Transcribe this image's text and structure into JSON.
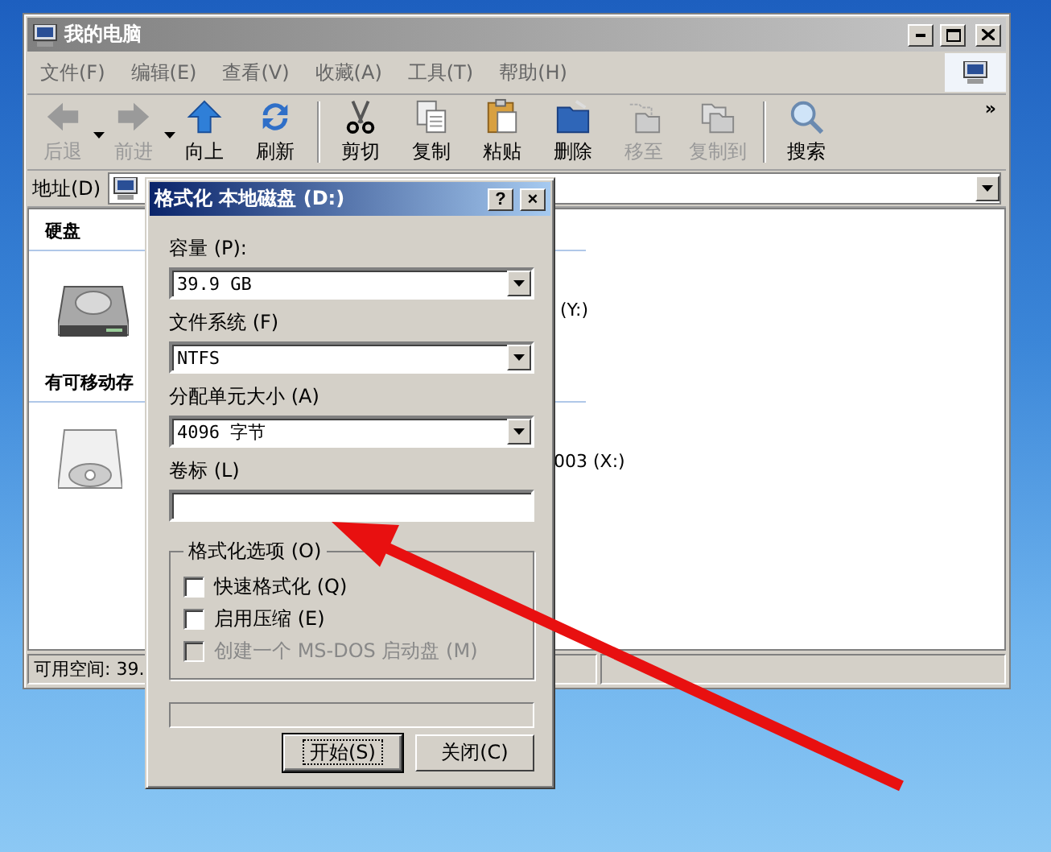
{
  "explorer": {
    "title": "我的电脑",
    "menu": [
      "文件(F)",
      "编辑(E)",
      "查看(V)",
      "收藏(A)",
      "工具(T)",
      "帮助(H)"
    ],
    "toolbar": [
      {
        "kind": "back",
        "label": "后退",
        "disabled": true,
        "dropdown": true
      },
      {
        "kind": "forward",
        "label": "前进",
        "disabled": true,
        "dropdown": true
      },
      {
        "kind": "up",
        "label": "向上",
        "disabled": false,
        "dropdown": false
      },
      {
        "kind": "refresh",
        "label": "刷新",
        "disabled": false,
        "dropdown": false
      },
      {
        "kind": "separator"
      },
      {
        "kind": "cut",
        "label": "剪切",
        "disabled": false,
        "dropdown": false
      },
      {
        "kind": "copy",
        "label": "复制",
        "disabled": false,
        "dropdown": false
      },
      {
        "kind": "paste",
        "label": "粘贴",
        "disabled": false,
        "dropdown": false
      },
      {
        "kind": "delete",
        "label": "删除",
        "disabled": false,
        "dropdown": false
      },
      {
        "kind": "moveto",
        "label": "移至",
        "disabled": true,
        "dropdown": false
      },
      {
        "kind": "copyto",
        "label": "复制到",
        "disabled": true,
        "dropdown": false
      },
      {
        "kind": "separator"
      },
      {
        "kind": "search",
        "label": "搜索",
        "disabled": false,
        "dropdown": false
      }
    ],
    "more": "»",
    "address": {
      "label": "地址(D)"
    },
    "groups": [
      {
        "heading": "硬盘",
        "items": [
          {
            "kind": "hdd",
            "label": "(Y:)"
          }
        ]
      },
      {
        "heading": "有可移动存",
        "items": [
          {
            "kind": "cd",
            "label": "003 (X:)"
          }
        ]
      }
    ],
    "status_bar": [
      "可用空间: 39."
    ]
  },
  "dialog": {
    "title": "格式化 本地磁盘 (D:)",
    "help": "?",
    "close": "×",
    "fields": [
      {
        "kind": "select",
        "label": "容量 (P):",
        "value": "39.9 GB"
      },
      {
        "kind": "select",
        "label": "文件系统 (F)",
        "value": "NTFS"
      },
      {
        "kind": "select",
        "label": "分配单元大小 (A)",
        "value": "4096 字节"
      },
      {
        "kind": "text",
        "label": "卷标 (L)"
      }
    ],
    "options": {
      "title": "格式化选项 (O)",
      "items": [
        {
          "label": "快速格式化 (Q)",
          "checked": false,
          "disabled": false
        },
        {
          "label": "启用压缩 (E)",
          "checked": false,
          "disabled": false
        },
        {
          "label": "创建一个 MS-DOS 启动盘 (M)",
          "checked": false,
          "disabled": true
        }
      ]
    },
    "progress": {
      "level": 0
    },
    "buttons": [
      {
        "label": "开始(S)",
        "selected": true
      },
      {
        "label": "关闭(C)",
        "selected": false
      }
    ]
  }
}
